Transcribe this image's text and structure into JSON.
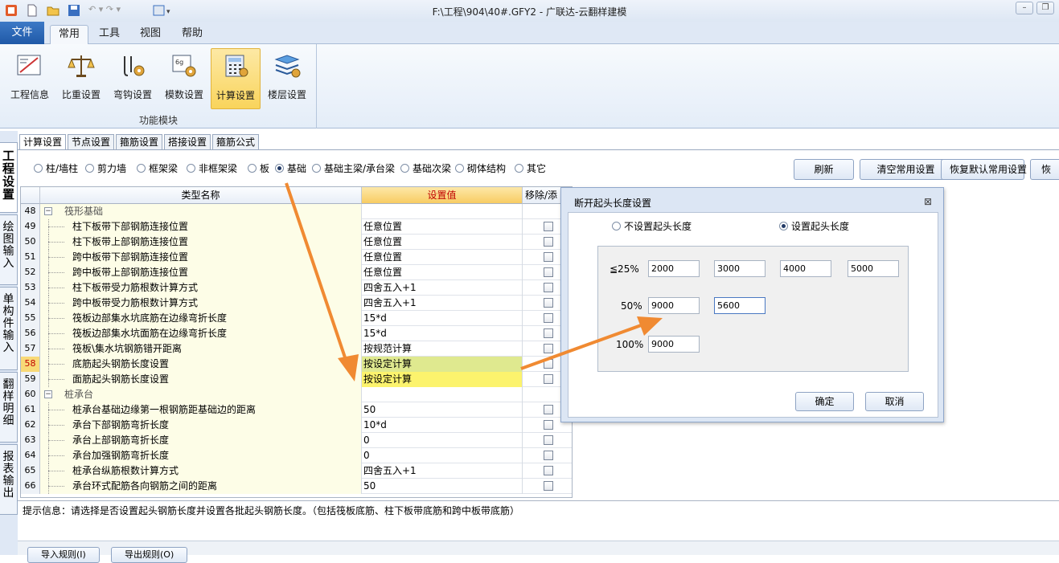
{
  "window": {
    "title": "F:\\工程\\904\\40#.GFY2 - 广联达-云翻样建模"
  },
  "ribbon_tabs": {
    "file": "文件",
    "common": "常用",
    "tools": "工具",
    "view": "视图",
    "help": "帮助"
  },
  "ribbon": {
    "buttons": [
      "工程信息",
      "比重设置",
      "弯钩设置",
      "模数设置",
      "计算设置",
      "楼层设置"
    ],
    "group_label": "功能模块"
  },
  "side_tabs": [
    "工程设置",
    "绘图输入",
    "单构件输入",
    "翻样明细",
    "报表输出"
  ],
  "sub_tabs": [
    "计算设置",
    "节点设置",
    "箍筋设置",
    "搭接设置",
    "箍筋公式"
  ],
  "radios": [
    "柱/墙柱",
    "剪力墙",
    "框架梁",
    "非框架梁",
    "板",
    "基础",
    "基础主梁/承台梁",
    "基础次梁",
    "砌体结构",
    "其它"
  ],
  "selected_radio": "基础",
  "actions": {
    "refresh": "刷新",
    "clear": "清空常用设置",
    "restore": "恢复默认常用设置",
    "more": "恢"
  },
  "grid": {
    "headers": {
      "name": "类型名称",
      "value": "设置值",
      "remove": "移除/添"
    },
    "rows": [
      {
        "n": "48",
        "name": "筏形基础",
        "value": "",
        "group": true
      },
      {
        "n": "49",
        "name": "柱下板带下部钢筋连接位置",
        "value": "任意位置"
      },
      {
        "n": "50",
        "name": "柱下板带上部钢筋连接位置",
        "value": "任意位置"
      },
      {
        "n": "51",
        "name": "跨中板带下部钢筋连接位置",
        "value": "任意位置"
      },
      {
        "n": "52",
        "name": "跨中板带上部钢筋连接位置",
        "value": "任意位置"
      },
      {
        "n": "53",
        "name": "柱下板带受力筋根数计算方式",
        "value": "四舍五入+1"
      },
      {
        "n": "54",
        "name": "跨中板带受力筋根数计算方式",
        "value": "四舍五入+1"
      },
      {
        "n": "55",
        "name": "筏板边部集水坑底筋在边缘弯折长度",
        "value": "15*d"
      },
      {
        "n": "56",
        "name": "筏板边部集水坑面筋在边缘弯折长度",
        "value": "15*d"
      },
      {
        "n": "57",
        "name": "筏板\\集水坑钢筋错开距离",
        "value": "按规范计算"
      },
      {
        "n": "58",
        "name": "底筋起头钢筋长度设置",
        "value": "按设定计算"
      },
      {
        "n": "59",
        "name": "面筋起头钢筋长度设置",
        "value": "按设定计算"
      },
      {
        "n": "60",
        "name": "桩承台",
        "value": "",
        "group": true
      },
      {
        "n": "61",
        "name": "桩承台基础边缘第一根钢筋距基础边的距离",
        "value": "50"
      },
      {
        "n": "62",
        "name": "承台下部钢筋弯折长度",
        "value": "10*d"
      },
      {
        "n": "63",
        "name": "承台上部钢筋弯折长度",
        "value": "0"
      },
      {
        "n": "64",
        "name": "承台加强钢筋弯折长度",
        "value": "0"
      },
      {
        "n": "65",
        "name": "桩承台纵筋根数计算方式",
        "value": "四舍五入+1"
      },
      {
        "n": "66",
        "name": "承台环式配筋各向钢筋之间的距离",
        "value": "50"
      }
    ]
  },
  "hint": "提示信息：请选择是否设置起头钢筋长度并设置各批起头钢筋长度。（包括筏板底筋、柱下板带底筋和跨中板带底筋）",
  "bottom_buttons": [
    "导入规则(I)",
    "导出规则(O)"
  ],
  "dialog": {
    "title": "断开起头长度设置",
    "option_none": "不设置起头长度",
    "option_set": "设置起头长度",
    "selected": "设置起头长度",
    "rows": [
      {
        "label": "≦25%",
        "values": [
          "2000",
          "3000",
          "4000",
          "5000"
        ]
      },
      {
        "label": "50%",
        "values": [
          "9000",
          "5600"
        ]
      },
      {
        "label": "100%",
        "values": [
          "9000"
        ]
      }
    ],
    "ok": "确定",
    "cancel": "取消"
  },
  "colors": {
    "accent_blue": "#1f59a7",
    "ribbon_active": "#f9d45c",
    "header_value": "#c00000",
    "arrow": "#f08a32",
    "selected_value": "#dfe98f",
    "selected_value2": "#fcf36d"
  }
}
